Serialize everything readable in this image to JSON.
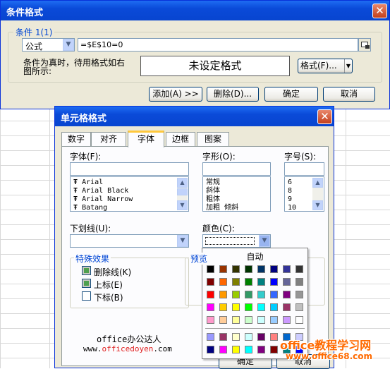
{
  "cond_dialog": {
    "title": "条件格式",
    "close_glyph": "✕",
    "group_label": "条件 1(1)",
    "type_select": "公式",
    "formula": "=$E$10=0",
    "desc_line1": "条件为真时，待用格式如右",
    "desc_line2": "图所示:",
    "preview_text": "未设定格式",
    "format_button": "格式(F)...",
    "add_button": "添加(A) >>",
    "delete_button": "删除(D)...",
    "ok_button": "确定",
    "cancel_button": "取消"
  },
  "cell_dialog": {
    "title": "单元格格式",
    "close_glyph": "✕",
    "tabs": [
      "数字",
      "对齐",
      "字体",
      "边框",
      "图案"
    ],
    "font_label": "字体(F):",
    "font_list": [
      "Arial",
      "Arial Black",
      "Arial Narrow",
      "Batang"
    ],
    "style_label": "字形(O):",
    "style_list": [
      "常规",
      "斜体",
      "粗体",
      "加粗 倾斜"
    ],
    "size_label": "字号(S):",
    "size_list": [
      "6",
      "8",
      "9",
      "10"
    ],
    "underline_label": "下划线(U):",
    "color_label": "颜色(C):",
    "effects_label": "特殊效果",
    "effects": [
      {
        "label": "删除线(K)",
        "state": "indeterminate"
      },
      {
        "label": "上标(E)",
        "state": "indeterminate"
      },
      {
        "label": "下标(B)",
        "state": "unchecked"
      }
    ],
    "preview_label": "预览",
    "ok_button": "确定",
    "cancel_button": "取消"
  },
  "color_palette": {
    "auto_label": "自动",
    "rows": [
      [
        "#000000",
        "#993300",
        "#333300",
        "#003300",
        "#003366",
        "#000080",
        "#333399",
        "#333333"
      ],
      [
        "#800000",
        "#ff6600",
        "#808000",
        "#008000",
        "#008080",
        "#0000ff",
        "#666699",
        "#808080"
      ],
      [
        "#ff0000",
        "#ff9900",
        "#99cc00",
        "#339966",
        "#33cccc",
        "#3366ff",
        "#800080",
        "#969696"
      ],
      [
        "#ff00ff",
        "#ffcc00",
        "#ffff00",
        "#00ff00",
        "#00ffff",
        "#00ccff",
        "#993366",
        "#c0c0c0"
      ],
      [
        "#ff99cc",
        "#ffcc99",
        "#ffff99",
        "#ccffcc",
        "#ccffff",
        "#99ccff",
        "#cc99ff",
        "#ffffff"
      ]
    ],
    "rows2": [
      [
        "#9999ff",
        "#993366",
        "#ffffcc",
        "#ccffff",
        "#660066",
        "#ff8080",
        "#0066cc",
        "#ccccff"
      ],
      [
        "#000080",
        "#ff00ff",
        "#ffff00",
        "#00ffff",
        "#800080",
        "#800000",
        "#008080",
        "#0000ff"
      ]
    ]
  },
  "watermark": {
    "cn_text": "office办公达人",
    "url_prefix": "www.",
    "url_brand": "officedoyen",
    "url_suffix": ".com",
    "logo_text": "office教程学习网",
    "logo_url": "www.office68.com"
  }
}
